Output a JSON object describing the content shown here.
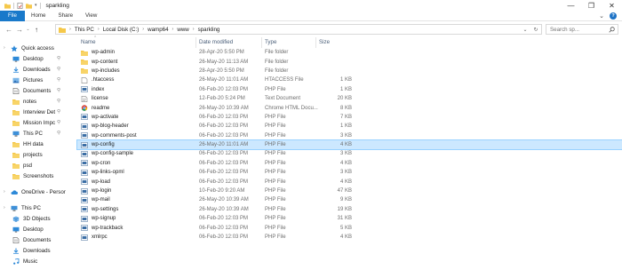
{
  "window": {
    "title": "sparkling",
    "controls": [
      "—",
      "❐",
      "✕"
    ]
  },
  "ribbon": {
    "tabs": [
      "File",
      "Home",
      "Share",
      "View"
    ]
  },
  "address": {
    "crumbs": [
      "This PC",
      "Local Disk (C:)",
      "wamp64",
      "www",
      "sparkling"
    ],
    "search_placeholder": "Search sp..."
  },
  "nav": {
    "items": [
      {
        "label": "Quick access",
        "icon": "star-icon",
        "level": 0,
        "pinned": false
      },
      {
        "label": "Desktop",
        "icon": "desktop-icon",
        "level": 1,
        "pinned": true
      },
      {
        "label": "Downloads",
        "icon": "downloads-icon",
        "level": 1,
        "pinned": true
      },
      {
        "label": "Pictures",
        "icon": "pictures-icon",
        "level": 1,
        "pinned": true
      },
      {
        "label": "Documents",
        "icon": "documents-icon",
        "level": 1,
        "pinned": true
      },
      {
        "label": "notes",
        "icon": "folder-icon",
        "level": 1,
        "pinned": true
      },
      {
        "label": "Interview Det",
        "icon": "folder-icon",
        "level": 1,
        "pinned": true
      },
      {
        "label": "Mission Impc",
        "icon": "folder-icon",
        "level": 1,
        "pinned": true
      },
      {
        "label": "This PC",
        "icon": "pc-icon",
        "level": 1,
        "pinned": true
      },
      {
        "label": "HH data",
        "icon": "folder-icon",
        "level": 1,
        "pinned": false
      },
      {
        "label": "projects",
        "icon": "folder-icon",
        "level": 1,
        "pinned": false
      },
      {
        "label": "psd",
        "icon": "folder-icon",
        "level": 1,
        "pinned": false
      },
      {
        "label": "Screenshots",
        "icon": "folder-icon",
        "level": 1,
        "pinned": false
      },
      {
        "label": "OneDrive - Persor",
        "icon": "cloud-icon",
        "level": 0,
        "pinned": false,
        "gap": true
      },
      {
        "label": "This PC",
        "icon": "pc-icon",
        "level": 0,
        "pinned": false,
        "gap": true
      },
      {
        "label": "3D Objects",
        "icon": "cube-icon",
        "level": 1,
        "pinned": false
      },
      {
        "label": "Desktop",
        "icon": "desktop-icon",
        "level": 1,
        "pinned": false
      },
      {
        "label": "Documents",
        "icon": "documents-icon",
        "level": 1,
        "pinned": false
      },
      {
        "label": "Downloads",
        "icon": "downloads-icon",
        "level": 1,
        "pinned": false
      },
      {
        "label": "Music",
        "icon": "music-icon",
        "level": 1,
        "pinned": false
      }
    ]
  },
  "columns": {
    "name": "Name",
    "date": "Date modified",
    "type": "Type",
    "size": "Size"
  },
  "files": [
    {
      "name": "wp-admin",
      "date": "28-Apr-20 5:50 PM",
      "type": "File folder",
      "size": "",
      "icon": "folder-icon"
    },
    {
      "name": "wp-content",
      "date": "26-May-20 11:13 AM",
      "type": "File folder",
      "size": "",
      "icon": "folder-icon"
    },
    {
      "name": "wp-includes",
      "date": "28-Apr-20 5:50 PM",
      "type": "File folder",
      "size": "",
      "icon": "folder-icon"
    },
    {
      "name": ".htaccess",
      "date": "26-May-20 11:01 AM",
      "type": "HTACCESS File",
      "size": "1 KB",
      "icon": "blank-file-icon"
    },
    {
      "name": "index",
      "date": "06-Feb-20 12:03 PM",
      "type": "PHP File",
      "size": "1 KB",
      "icon": "php-file-icon"
    },
    {
      "name": "license",
      "date": "12-Feb-20 5:24 PM",
      "type": "Text Document",
      "size": "20 KB",
      "icon": "text-file-icon"
    },
    {
      "name": "readme",
      "date": "26-May-20 10:39 AM",
      "type": "Chrome HTML Docu...",
      "size": "8 KB",
      "icon": "chrome-icon"
    },
    {
      "name": "wp-activate",
      "date": "06-Feb-20 12:03 PM",
      "type": "PHP File",
      "size": "7 KB",
      "icon": "php-file-icon"
    },
    {
      "name": "wp-blog-header",
      "date": "06-Feb-20 12:03 PM",
      "type": "PHP File",
      "size": "1 KB",
      "icon": "php-file-icon"
    },
    {
      "name": "wp-comments-post",
      "date": "06-Feb-20 12:03 PM",
      "type": "PHP File",
      "size": "3 KB",
      "icon": "php-file-icon"
    },
    {
      "name": "wp-config",
      "date": "26-May-20 11:01 AM",
      "type": "PHP File",
      "size": "4 KB",
      "icon": "php-file-icon",
      "selected": true
    },
    {
      "name": "wp-config-sample",
      "date": "06-Feb-20 12:03 PM",
      "type": "PHP File",
      "size": "3 KB",
      "icon": "php-file-icon"
    },
    {
      "name": "wp-cron",
      "date": "06-Feb-20 12:03 PM",
      "type": "PHP File",
      "size": "4 KB",
      "icon": "php-file-icon"
    },
    {
      "name": "wp-links-opml",
      "date": "06-Feb-20 12:03 PM",
      "type": "PHP File",
      "size": "3 KB",
      "icon": "php-file-icon"
    },
    {
      "name": "wp-load",
      "date": "06-Feb-20 12:03 PM",
      "type": "PHP File",
      "size": "4 KB",
      "icon": "php-file-icon"
    },
    {
      "name": "wp-login",
      "date": "10-Feb-20 9:20 AM",
      "type": "PHP File",
      "size": "47 KB",
      "icon": "php-file-icon"
    },
    {
      "name": "wp-mail",
      "date": "26-May-20 10:39 AM",
      "type": "PHP File",
      "size": "9 KB",
      "icon": "php-file-icon"
    },
    {
      "name": "wp-settings",
      "date": "26-May-20 10:39 AM",
      "type": "PHP File",
      "size": "19 KB",
      "icon": "php-file-icon"
    },
    {
      "name": "wp-signup",
      "date": "06-Feb-20 12:03 PM",
      "type": "PHP File",
      "size": "31 KB",
      "icon": "php-file-icon"
    },
    {
      "name": "wp-trackback",
      "date": "06-Feb-20 12:03 PM",
      "type": "PHP File",
      "size": "5 KB",
      "icon": "php-file-icon"
    },
    {
      "name": "xmlrpc",
      "date": "06-Feb-20 12:03 PM",
      "type": "PHP File",
      "size": "4 KB",
      "icon": "php-file-icon"
    }
  ],
  "colors": {
    "file_tab": "#1979ca",
    "folder": "#f5c84a",
    "selection": "#cce8ff",
    "selection_border": "#99d1ff"
  }
}
